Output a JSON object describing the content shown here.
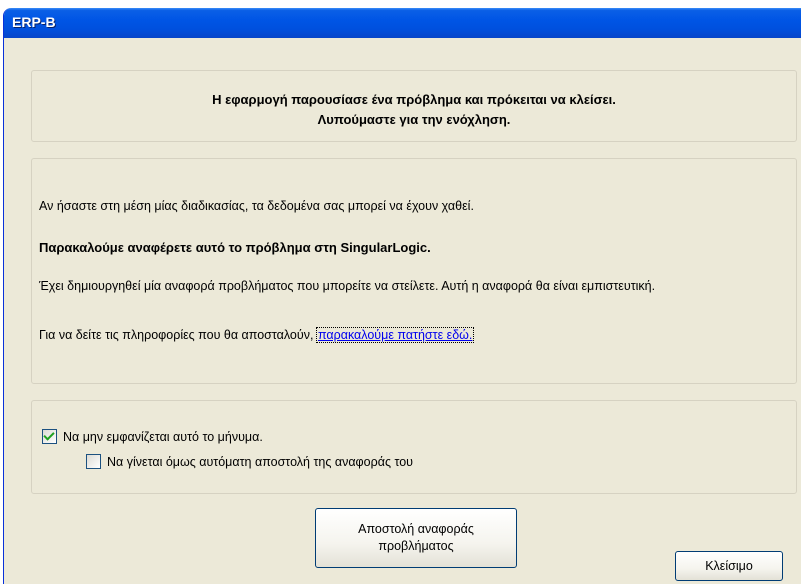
{
  "window": {
    "title": "ERP-B"
  },
  "header": {
    "message": "Η εφαρμογή παρουσίασε ένα πρόβλημα και πρόκειται να κλείσει. Λυπούμαστε για την ενόχληση."
  },
  "info": {
    "line1": "Αν ήσαστε στη μέση μίας διαδικασίας, τα δεδομένα σας μπορεί να έχουν χαθεί.",
    "line2": "Παρακαλούμε αναφέρετε αυτό το πρόβλημα στη SingularLogic.",
    "line3": "Έχει δημιουργηθεί μία αναφορά προβλήματος που μπορείτε να στείλετε. Αυτή η αναφορά θα είναι εμπιστευτική.",
    "line4_prefix": "Για να δείτε τις πληροφορίες που θα αποσταλούν,",
    "line4_link": "παρακαλούμε πατήστε εδώ."
  },
  "options": {
    "dont_show": {
      "label": "Να μην εμφανίζεται αυτό το μήνυμα.",
      "checked": true
    },
    "auto_send": {
      "label": "Να γίνεται όμως αυτόματη αποστολή της αναφοράς του",
      "checked": false
    }
  },
  "buttons": {
    "send": "Αποστολή αναφοράς προβλήματος",
    "close": "Κλείσιμο"
  }
}
